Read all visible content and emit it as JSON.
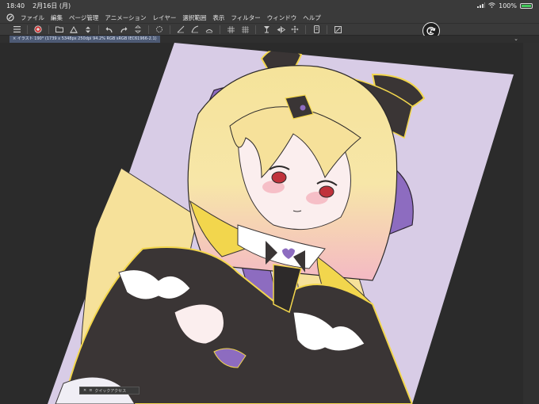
{
  "status": {
    "time": "18:40",
    "date": "2月16日 (月)",
    "battery": "100%",
    "battery_level": 1.0
  },
  "menu": {
    "items": [
      "ファイル",
      "編集",
      "ページ管理",
      "アニメーション",
      "レイヤー",
      "選択範囲",
      "表示",
      "フィルター",
      "ウィンドウ",
      "ヘルプ"
    ]
  },
  "toolbar": {
    "icons": [
      "menu-icon",
      "clip-studio-icon",
      "open-folder-icon",
      "save-icon",
      "export-icon",
      "undo-icon",
      "redo-icon",
      "transform-icon",
      "loading-icon",
      "correct-line-icon",
      "smooth-line-icon",
      "border-icon",
      "grid-icon",
      "ruler-icon",
      "snap-icon",
      "flip-horizontal-icon",
      "rotate-icon",
      "smartphone-icon",
      "fit-icon"
    ]
  },
  "document": {
    "tab_label": "イラスト 190° (1739 x 5348px 250dpi 94.2% RGB sRGB IEC61966-2.1)"
  },
  "quick_access": {
    "label": "クイックアクセス"
  },
  "colors": {
    "canvas_bg": "#d8cce6",
    "hair": "#f5e39a",
    "hair_tip": "#f4b9c4",
    "dress": "#3a3535",
    "ribbon": "#8d6cc0",
    "accent_yellow": "#f2d64d",
    "eye": "#c0323b"
  }
}
